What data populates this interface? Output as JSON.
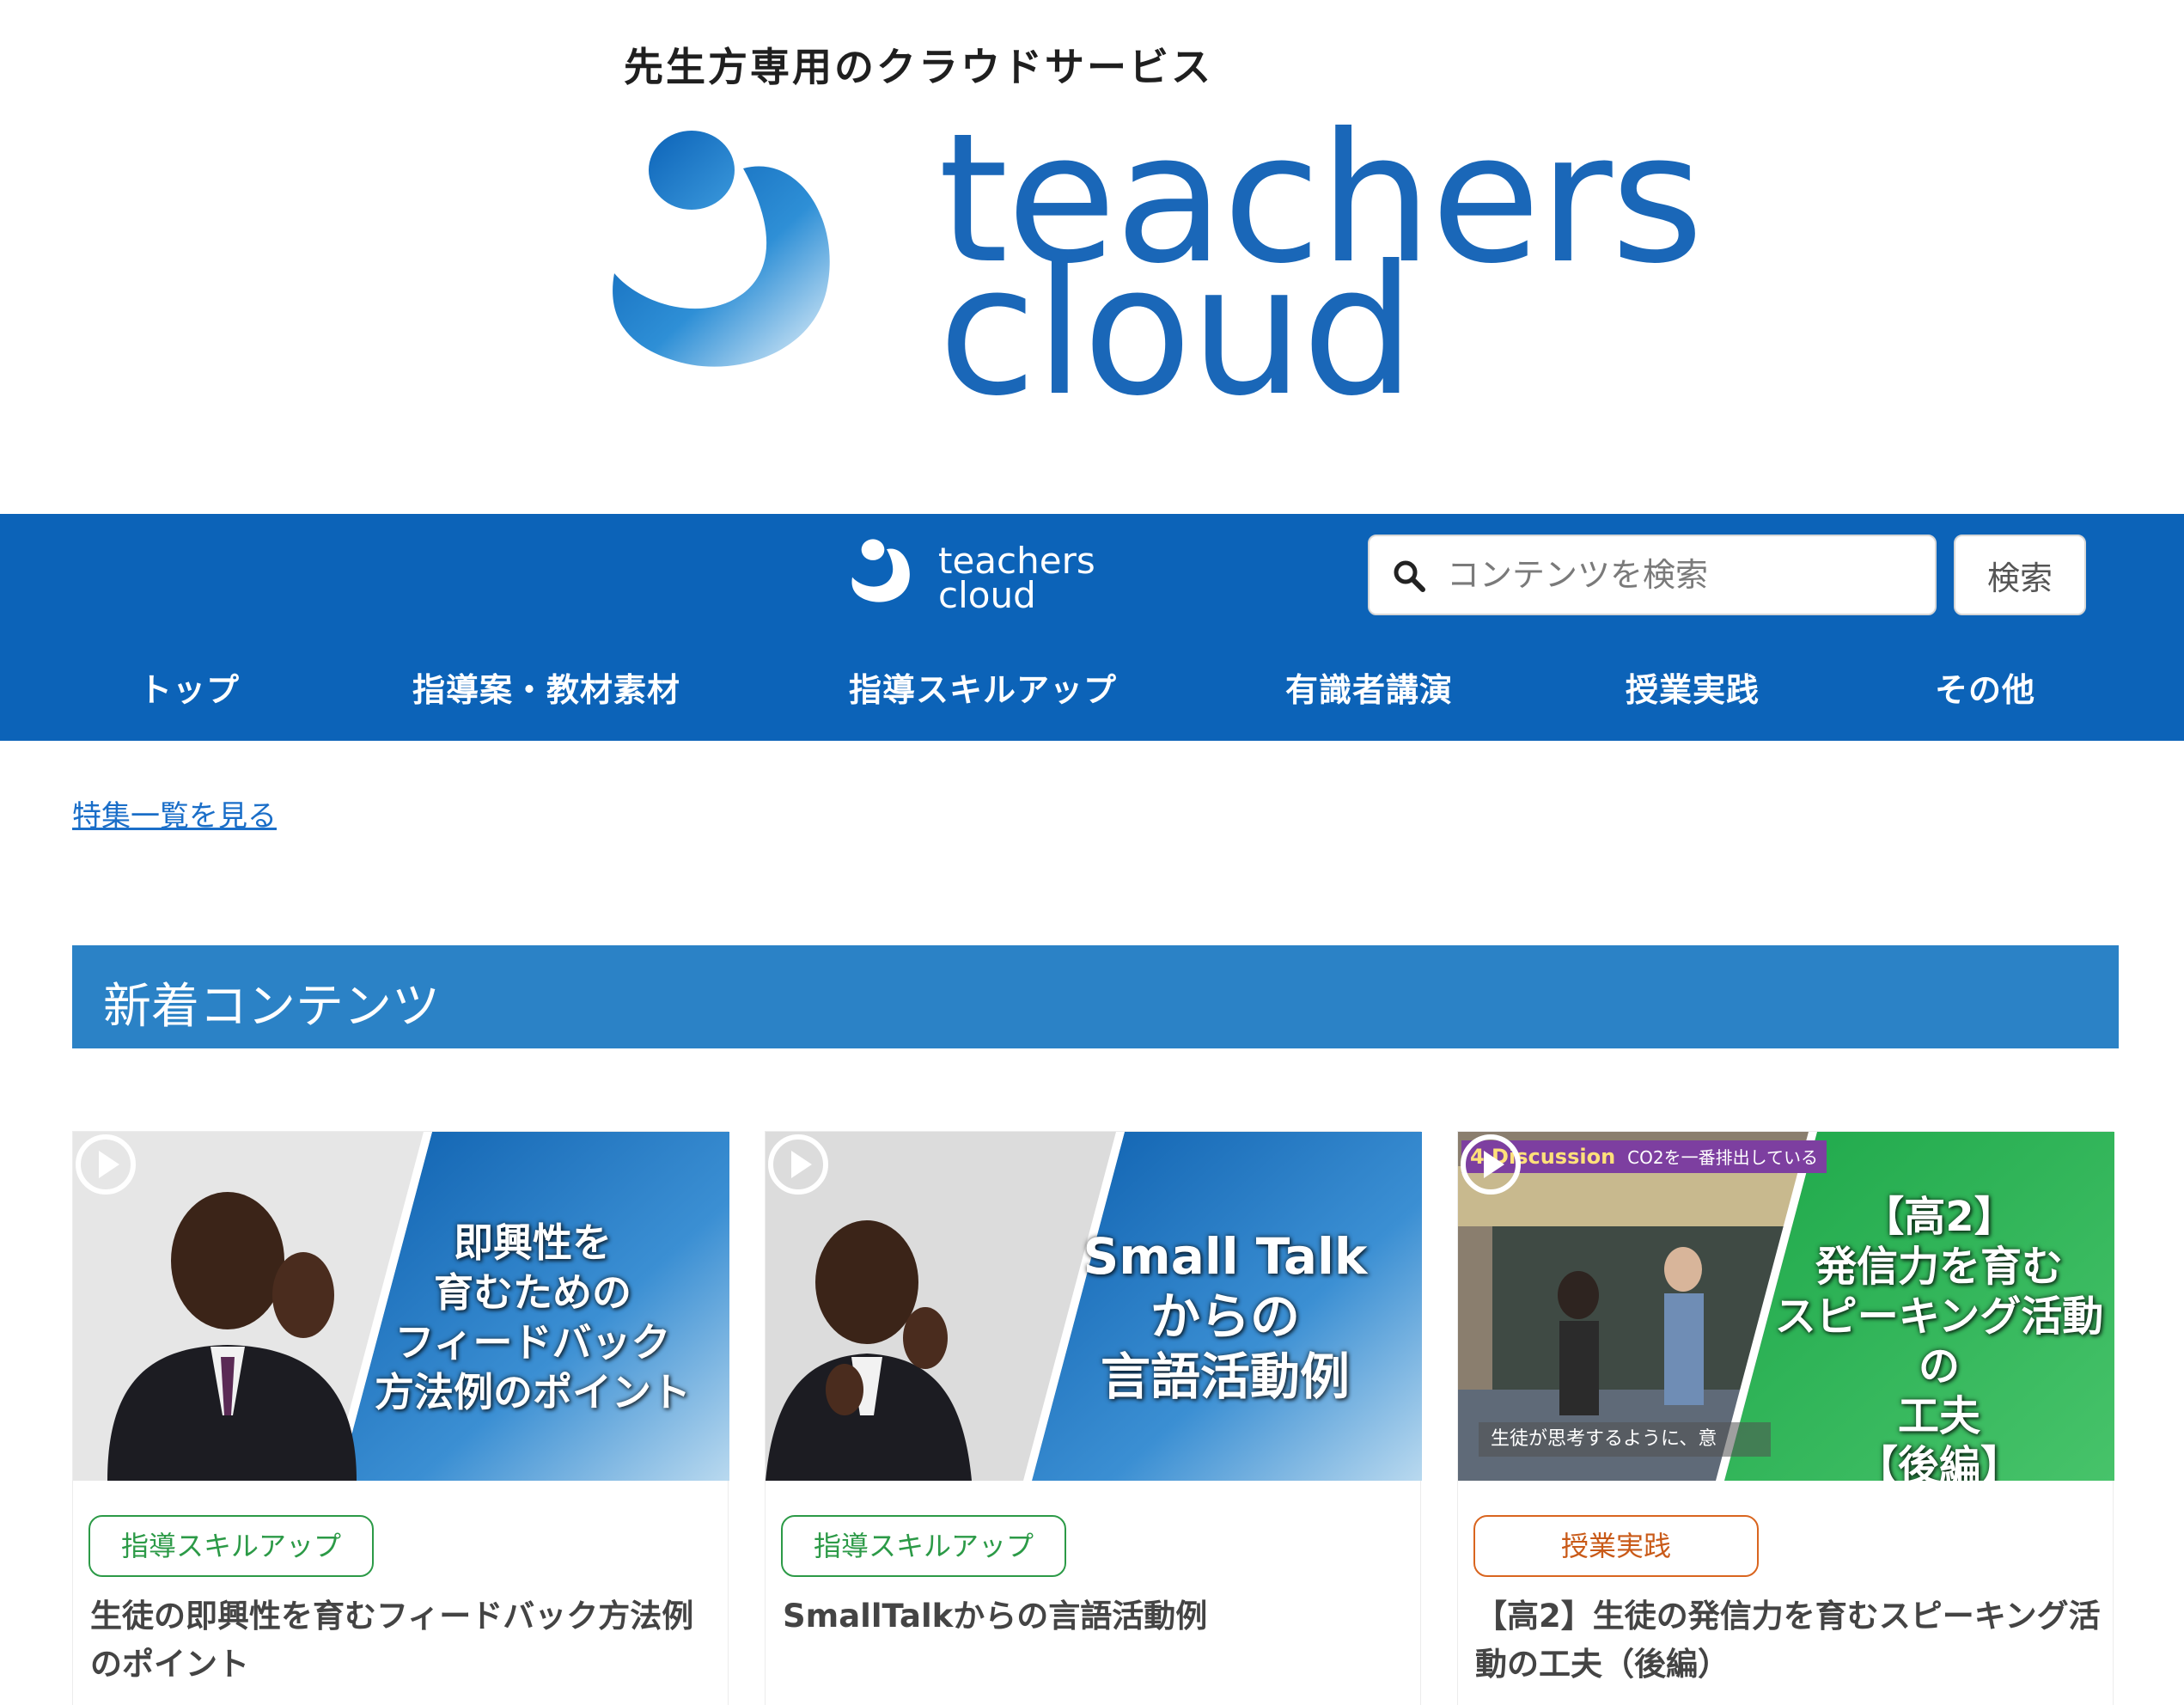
{
  "hero": {
    "tagline": "先生方専用のクラウドサービス",
    "word_line1": "teachers",
    "word_line2": "cloud"
  },
  "header": {
    "logo_line1": "teachers",
    "logo_line2": "cloud",
    "search_placeholder": "コンテンツを検索",
    "search_button": "検索"
  },
  "nav": [
    {
      "label": "トップ"
    },
    {
      "label": "指導案・教材素材"
    },
    {
      "label": "指導スキルアップ"
    },
    {
      "label": "有識者講演"
    },
    {
      "label": "授業実践"
    },
    {
      "label": "その他"
    }
  ],
  "features_link": "特集一覧を見る",
  "section": {
    "title": "新着コンテンツ"
  },
  "cards": [
    {
      "thumb_lines": [
        "即興性を",
        "育むための",
        "フィードバック",
        "方法例のポイント"
      ],
      "tag": "指導スキルアップ",
      "tag_color": "#2c9a47",
      "title": "生徒の即興性を育むフィードバック方法例のポイント"
    },
    {
      "thumb_lines": [
        "Small Talk",
        "からの",
        "言語活動例"
      ],
      "tag": "指導スキルアップ",
      "tag_color": "#2c9a47",
      "title": "SmallTalkからの言語活動例"
    },
    {
      "thumb_lines": [
        "【高2】",
        "発信力を育む",
        "スピーキング活動の",
        "工夫",
        "【後編】"
      ],
      "thumb_badge": "4 Discussion",
      "thumb_badge_sub": "CO2を一番排出している",
      "thumb_caption": "生徒が思考するように、意",
      "tag": "授業実践",
      "tag_color": "#d9651f",
      "title": "【高2】生徒の発信力を育むスピーキング活動の工夫（後編）"
    }
  ],
  "colors": {
    "brand_blue": "#0c63b8",
    "section_blue": "#2b82c6",
    "link_blue": "#1a6ec8",
    "thumb_green": "#2eb04e"
  }
}
